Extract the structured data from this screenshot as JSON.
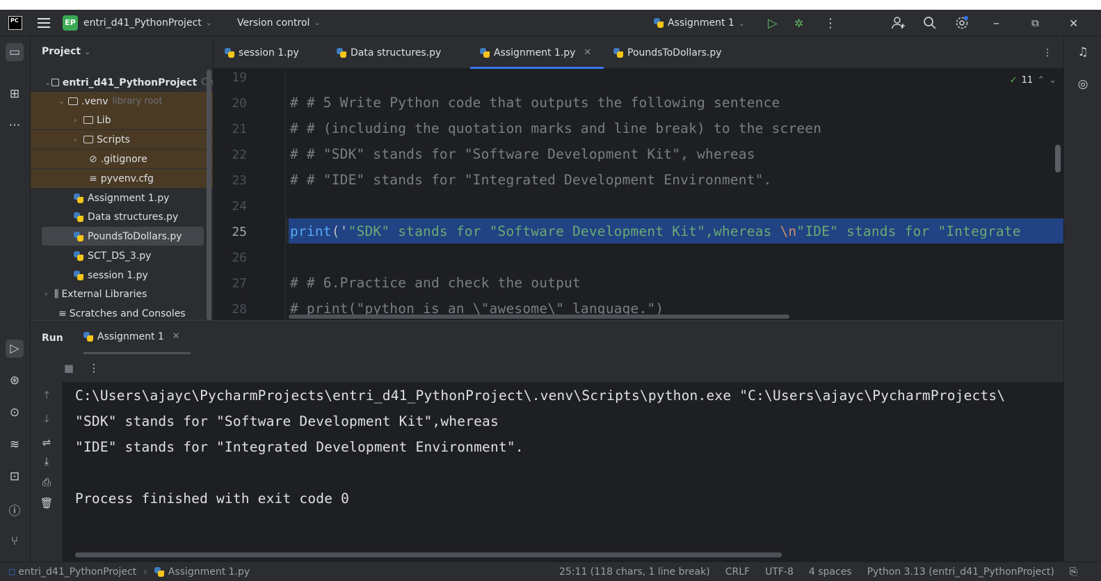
{
  "titlebar": {
    "project_badge": "EP",
    "project_name": "entri_d41_PythonProject",
    "version_control": "Version control",
    "run_config": "Assignment 1",
    "minimize": "–",
    "restore": "⧉",
    "close": "✕"
  },
  "project_panel": {
    "title": "Project",
    "tree": [
      {
        "label": "entri_d41_PythonProject",
        "suffix": "C:\\",
        "type": "folder"
      },
      {
        "label": ".venv",
        "suffix": "library root",
        "type": "folder"
      },
      {
        "label": "Lib",
        "type": "folder"
      },
      {
        "label": "Scripts",
        "type": "folder"
      },
      {
        "label": ".gitignore",
        "type": "file"
      },
      {
        "label": "pyvenv.cfg",
        "type": "file"
      },
      {
        "label": "Assignment 1.py",
        "type": "py"
      },
      {
        "label": "Data structures.py",
        "type": "py"
      },
      {
        "label": "PoundsToDollars.py",
        "type": "py"
      },
      {
        "label": "SCT_DS_3.py",
        "type": "py"
      },
      {
        "label": "session 1.py",
        "type": "py"
      },
      {
        "label": "External Libraries",
        "type": "lib"
      },
      {
        "label": "Scratches and Consoles",
        "type": "scratch"
      }
    ]
  },
  "editor": {
    "tabs": [
      {
        "label": "session 1.py"
      },
      {
        "label": "Data structures.py"
      },
      {
        "label": "Assignment 1.py",
        "active": true
      },
      {
        "label": "PoundsToDollars.py"
      }
    ],
    "inspection_count": "11",
    "lines": [
      {
        "num": "19",
        "text": ""
      },
      {
        "num": "20",
        "text": "# # 5 Write Python code that outputs the following sentence"
      },
      {
        "num": "21",
        "text": "# # (including the quotation marks and line break) to the screen"
      },
      {
        "num": "22",
        "text": "# # \"SDK\" stands for \"Software Development Kit\", whereas"
      },
      {
        "num": "23",
        "text": "# # \"IDE\" stands for \"Integrated Development Environment\"."
      },
      {
        "num": "24",
        "text": ""
      },
      {
        "num": "25",
        "text": ""
      },
      {
        "num": "26",
        "text": ""
      },
      {
        "num": "27",
        "text": "# # 6.Practice and check the output"
      },
      {
        "num": "28",
        "text": "# print(\"python is an \\\"awesome\\\" language.\")"
      }
    ],
    "line25": {
      "fn": "print",
      "open": "('",
      "str1": "\"SDK\" stands for \"Software Development Kit\",whereas ",
      "escape": "\\n",
      "str2": "\"IDE\" stands for \"Integrate"
    }
  },
  "run": {
    "title": "Run",
    "tab_label": "Assignment 1",
    "output": [
      "C:\\Users\\ajayc\\PycharmProjects\\entri_d41_PythonProject\\.venv\\Scripts\\python.exe \"C:\\Users\\ajayc\\PycharmProjects\\",
      "\"SDK\" stands for \"Software Development Kit\",whereas",
      "\"IDE\" stands for \"Integrated Development Environment\".",
      "",
      "Process finished with exit code 0"
    ]
  },
  "statusbar": {
    "breadcrumb_project": "entri_d41_PythonProject",
    "breadcrumb_file": "Assignment 1.py",
    "position": "25:11 (118 chars, 1 line break)",
    "line_sep": "CRLF",
    "encoding": "UTF-8",
    "indent": "4 spaces",
    "interpreter": "Python 3.13 (entri_d41_PythonProject)"
  },
  "colors": {
    "bg_panel": "#2b2d30",
    "bg_editor": "#1e1f22",
    "accent": "#3574f0",
    "selection": "#214283",
    "comment": "#7a7e85",
    "string": "#6aab73",
    "keyword": "#56a8f5"
  },
  "icons": {
    "app": "pycharm-logo-icon",
    "menu": "hamburger-menu-icon",
    "run": "run-icon",
    "debug": "debug-icon",
    "more": "more-vertical-icon",
    "add_user": "add-user-icon",
    "search": "search-icon",
    "settings": "gear-icon"
  }
}
